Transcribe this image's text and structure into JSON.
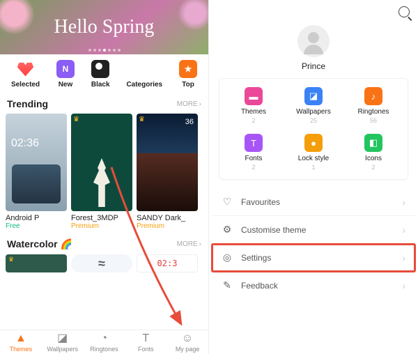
{
  "hero": {
    "title": "Hello Spring"
  },
  "cats": [
    {
      "label": "Selected",
      "icon": "heart-icon"
    },
    {
      "label": "New",
      "icon": "new-icon"
    },
    {
      "label": "Black",
      "icon": "black-icon"
    },
    {
      "label": "Categories",
      "icon": "grid-icon"
    },
    {
      "label": "Top",
      "icon": "star-icon"
    }
  ],
  "sections": {
    "trending": {
      "title": "Trending",
      "more": "More"
    },
    "watercolor": {
      "title": "Watercolor 🌈",
      "more": "More"
    }
  },
  "trending": [
    {
      "name": "Android P",
      "price": "Free",
      "time": "02:36"
    },
    {
      "name": "Forest_3MDP",
      "price": "Premium"
    },
    {
      "name": "SANDY Dark_",
      "price": "Premium",
      "time": "36"
    }
  ],
  "wc_time": "02:3",
  "bottom_nav": [
    {
      "label": "Themes",
      "icon": "themes-icon",
      "active": true
    },
    {
      "label": "Wallpapers",
      "icon": "wallpapers-icon"
    },
    {
      "label": "Ringtones",
      "icon": "ringtones-icon"
    },
    {
      "label": "Fonts",
      "icon": "fonts-icon"
    },
    {
      "label": "My page",
      "icon": "mypage-icon"
    }
  ],
  "right": {
    "username": "Prince",
    "tiles": [
      {
        "label": "Themes",
        "count": "2",
        "color": "c-pink",
        "glyph": "▬"
      },
      {
        "label": "Wallpapers",
        "count": "25",
        "color": "c-blue",
        "glyph": "◪"
      },
      {
        "label": "Ringtones",
        "count": "56",
        "color": "c-orange",
        "glyph": "♪"
      },
      {
        "label": "Fonts",
        "count": "2",
        "color": "c-purple",
        "glyph": "T"
      },
      {
        "label": "Lock style",
        "count": "1",
        "color": "c-amber",
        "glyph": "●"
      },
      {
        "label": "Icons",
        "count": "2",
        "color": "c-green",
        "glyph": "◧"
      }
    ],
    "menu": [
      {
        "label": "Favourites",
        "icon": "heart-outline-icon",
        "glyph": "♡"
      },
      {
        "label": "Customise theme",
        "icon": "sliders-icon",
        "glyph": "⚙"
      },
      {
        "label": "Settings",
        "icon": "settings-icon",
        "glyph": "◎",
        "highlight": true
      },
      {
        "label": "Feedback",
        "icon": "feedback-icon",
        "glyph": "✎"
      }
    ]
  }
}
